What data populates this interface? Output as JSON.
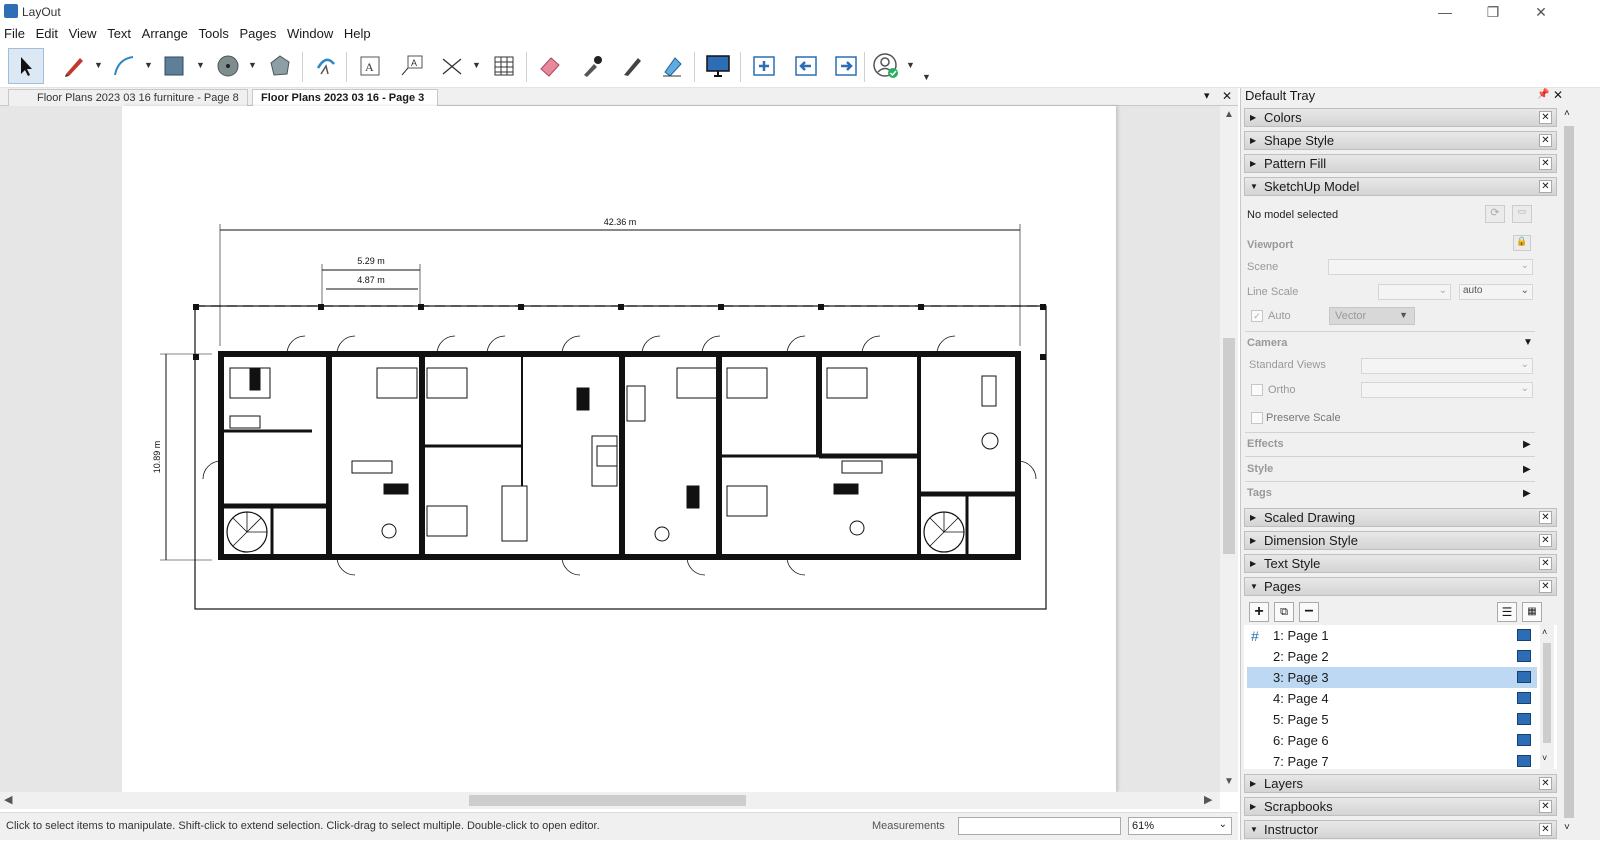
{
  "window": {
    "title": "LayOut",
    "minimize": "—",
    "restore": "❐",
    "close": "✕"
  },
  "menu": [
    "File",
    "Edit",
    "View",
    "Text",
    "Arrange",
    "Tools",
    "Pages",
    "Window",
    "Help"
  ],
  "doc_tabs": [
    {
      "label": "Floor Plans 2023 03 16 furniture - Page 8",
      "active": false
    },
    {
      "label": "Floor Plans 2023 03 16 - Page 3",
      "active": true
    }
  ],
  "doc_tabs_controls": {
    "dropdown": "▾",
    "close": "✕"
  },
  "drawing": {
    "dim_overall_width": "42.36 m",
    "dim_unit_outer": "5.29 m",
    "dim_unit_inner": "4.87 m",
    "dim_depth": "10.89 m"
  },
  "statusbar": {
    "hint": "Click to select items to manipulate. Shift-click to extend selection. Click-drag to select multiple. Double-click to open editor.",
    "measurements_label": "Measurements",
    "measurements_value": "",
    "zoom": "61%"
  },
  "tray": {
    "title": "Default Tray",
    "panels_top": [
      {
        "label": "Colors",
        "expanded": false
      },
      {
        "label": "Shape Style",
        "expanded": false
      },
      {
        "label": "Pattern Fill",
        "expanded": false
      },
      {
        "label": "SketchUp Model",
        "expanded": true
      }
    ],
    "sketchup_model": {
      "status": "No model selected",
      "viewport": "Viewport",
      "scene": "Scene",
      "line_scale": "Line Scale",
      "line_scale_value": "auto",
      "auto": "Auto",
      "render_mode": "Vector",
      "camera": "Camera",
      "standard_views": "Standard Views",
      "ortho": "Ortho",
      "preserve_scale": "Preserve Scale",
      "effects": "Effects",
      "style": "Style",
      "tags": "Tags"
    },
    "panels_mid": [
      {
        "label": "Scaled Drawing",
        "expanded": false
      },
      {
        "label": "Dimension Style",
        "expanded": false
      },
      {
        "label": "Text Style",
        "expanded": false
      },
      {
        "label": "Pages",
        "expanded": true
      }
    ],
    "pages": [
      {
        "label": "1: Page 1",
        "selected": false
      },
      {
        "label": "2: Page 2",
        "selected": false
      },
      {
        "label": "3: Page 3",
        "selected": true
      },
      {
        "label": "4: Page 4",
        "selected": false
      },
      {
        "label": "5: Page 5",
        "selected": false
      },
      {
        "label": "6: Page 6",
        "selected": false
      },
      {
        "label": "7: Page 7",
        "selected": false
      }
    ],
    "panels_bottom": [
      {
        "label": "Layers",
        "expanded": false
      },
      {
        "label": "Scrapbooks",
        "expanded": false
      },
      {
        "label": "Instructor",
        "expanded": true
      }
    ]
  },
  "colors": {
    "accent": "#2c6db5",
    "selection": "#bcd8f2"
  }
}
